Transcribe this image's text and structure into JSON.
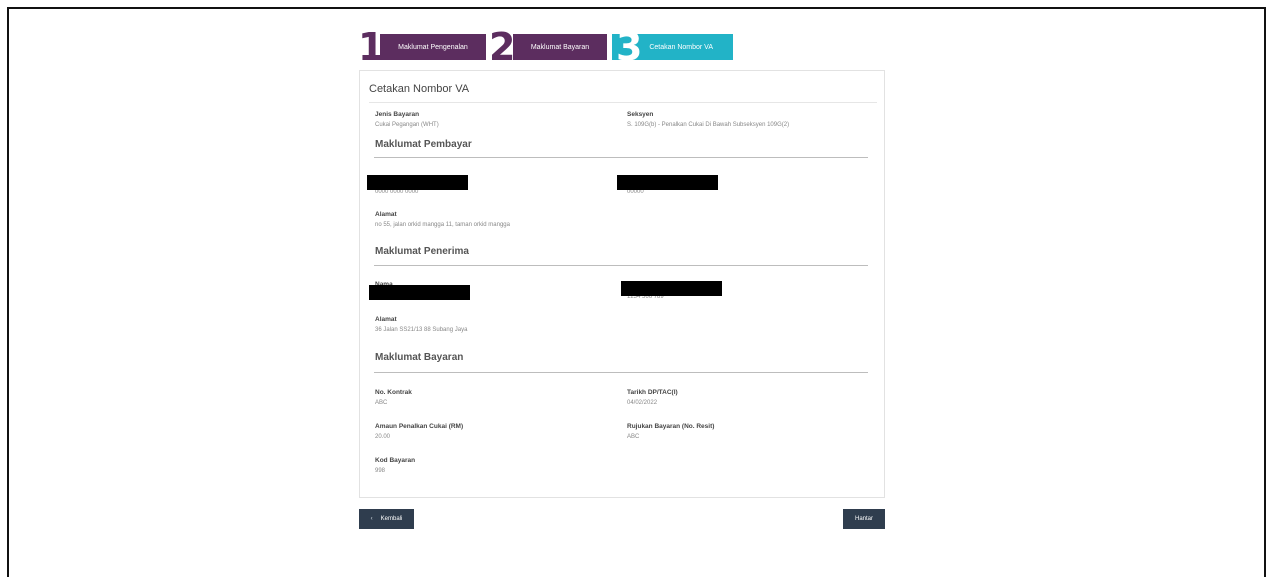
{
  "steps": [
    {
      "number": "1",
      "label": "Maklumat Pengenalan"
    },
    {
      "number": "2",
      "label": "Maklumat Bayaran"
    },
    {
      "number": "3",
      "label": "Cetakan Nombor VA"
    }
  ],
  "card_title": "Cetakan Nombor VA",
  "payment_info": {
    "jenis_label": "Jenis Bayaran",
    "jenis_value": "Cukai Pegangan (WHT)",
    "seksyen_label": "Seksyen",
    "seksyen_value": "S. 109G(b) - Penalkan Cukai Di Bawah Subseksyen 109G(2)"
  },
  "payer": {
    "title": "Maklumat Pembayar",
    "field1_value": "0000 0000 0000",
    "field2_value": "00000",
    "alamat_label": "Alamat",
    "alamat_value": "no 55, jalan orkid mangga 11, taman orkid mangga"
  },
  "recipient": {
    "title": "Maklumat Penerima",
    "field1_label": "Nama",
    "field2_value": "1234 566 789",
    "alamat_label": "Alamat",
    "alamat_value": "36 Jalan SS21/13 88 Subang Jaya"
  },
  "bayaran": {
    "title": "Maklumat Bayaran",
    "kontrak_label": "No. Kontrak",
    "kontrak_value": "ABC",
    "tarikh_label": "Tarikh DP/TAC(I)",
    "tarikh_value": "04/02/2022",
    "amaun_label": "Amaun Penalkan Cukai (RM)",
    "amaun_value": "20.00",
    "rujukan_label": "Rujukan Bayaran (No. Resit)",
    "rujukan_value": "ABC",
    "kod_label": "Kod Bayaran",
    "kod_value": "998"
  },
  "buttons": {
    "back_label": "Kembali",
    "back_icon": "chevron-left-icon",
    "next_label": "Hantar"
  },
  "colors": {
    "step_done": "#5c2d5f",
    "step_active": "#22b3c7",
    "button": "#2f3d4e"
  }
}
